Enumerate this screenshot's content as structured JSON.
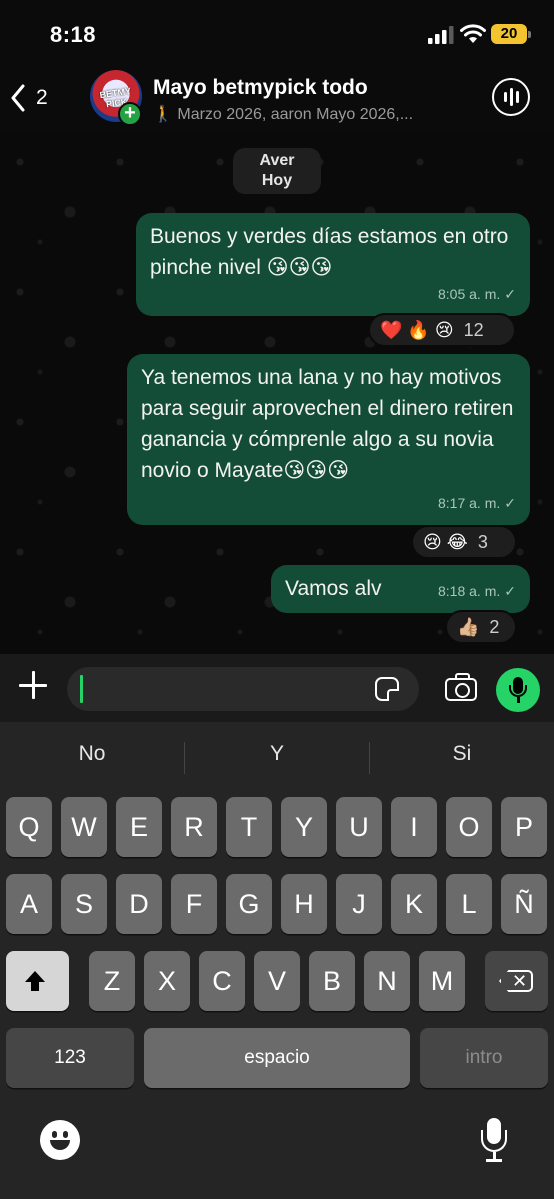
{
  "status_bar": {
    "time": "8:18",
    "battery": "20"
  },
  "header": {
    "back_count": "2",
    "avatar_text": "BETMY PICK",
    "title": "Mayo betmypick todo",
    "subtitle": "🚶 Marzo 2026, aaron Mayo 2026,..."
  },
  "chat": {
    "date_chip": {
      "line1": "Aver",
      "line2": "Hoy"
    },
    "messages": [
      {
        "text": "Buenos y verdes días estamos en otro pinche nivel 😘😘😘",
        "time": "8:05 a. m.",
        "status": "✓",
        "reactions": {
          "emojis": "❤️ 🔥 😢",
          "count": "12"
        }
      },
      {
        "text": "Ya tenemos una lana y no hay motivos para seguir aprovechen el dinero retiren ganancia y cómprenle algo a su novia novio o Mayate😘😘😘",
        "time": "8:17 a. m.",
        "status": "✓",
        "reactions": {
          "emojis": "😢 😂",
          "count": "3"
        }
      },
      {
        "text": "Vamos alv",
        "time": "8:18 a. m.",
        "status": "✓",
        "reactions": {
          "emojis": "👍🏼",
          "count": "2"
        }
      }
    ]
  },
  "input": {
    "value": ""
  },
  "keyboard": {
    "suggestions": [
      "No",
      "Y",
      "Si"
    ],
    "row1": [
      "Q",
      "W",
      "E",
      "R",
      "T",
      "Y",
      "U",
      "I",
      "O",
      "P"
    ],
    "row2": [
      "A",
      "S",
      "D",
      "F",
      "G",
      "H",
      "J",
      "K",
      "L",
      "Ñ"
    ],
    "row3": [
      "Z",
      "X",
      "C",
      "V",
      "B",
      "N",
      "M"
    ],
    "numbers_label": "123",
    "space_label": "espacio",
    "return_label": "intro"
  },
  "icons": {
    "back": "chevron-left-icon",
    "voice_chat": "voice-chat-icon",
    "plus": "plus-icon",
    "sticker": "sticker-icon",
    "camera": "camera-icon",
    "mic": "microphone-icon",
    "shift": "shift-icon",
    "backspace": "backspace-icon",
    "emoji": "emoji-icon",
    "dictation": "dictation-icon"
  },
  "colors": {
    "bubble": "#144d37",
    "accent": "#25d366",
    "battery": "#f4c430"
  }
}
